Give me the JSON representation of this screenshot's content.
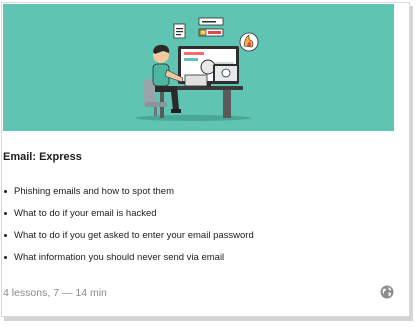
{
  "course": {
    "title": "Email: Express",
    "topics": [
      "Phishing emails and how to spot them",
      "What to do if your email is hacked",
      "What to do if you get asked to enter your email password",
      "What information you should never send via email"
    ],
    "meta": "4 lessons, 7 — 14 min",
    "banner_color": "#5fc4b1",
    "illustration": "person-at-computer-illustration",
    "language_icon": "globe-icon"
  }
}
